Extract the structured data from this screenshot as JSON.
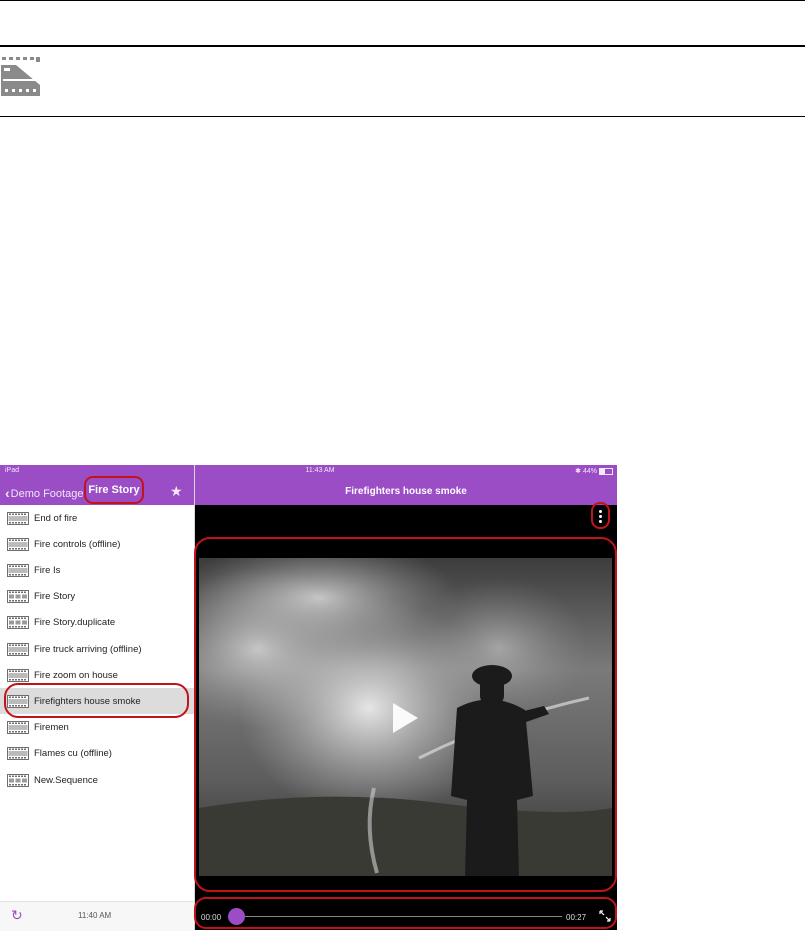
{
  "status_bar": {
    "device": "iPad",
    "time": "11:43 AM",
    "battery": "44%"
  },
  "sidebar": {
    "back_label": "Demo Footage",
    "folder_title": "Fire Story",
    "items": [
      {
        "label": "End of fire",
        "icon": "clip-film-icon",
        "selected": false
      },
      {
        "label": "Fire controls (offline)",
        "icon": "clip-film-icon",
        "selected": false
      },
      {
        "label": "Fire Is",
        "icon": "clip-film-icon",
        "selected": false
      },
      {
        "label": "Fire Story",
        "icon": "sequence-film-icon",
        "selected": false
      },
      {
        "label": "Fire Story.duplicate",
        "icon": "sequence-film-icon",
        "selected": false
      },
      {
        "label": "Fire truck arriving (offline)",
        "icon": "clip-film-icon",
        "selected": false
      },
      {
        "label": "Fire zoom on house",
        "icon": "clip-film-icon",
        "selected": false
      },
      {
        "label": "Firefighters house smoke",
        "icon": "clip-film-icon",
        "selected": true
      },
      {
        "label": "Firemen",
        "icon": "clip-film-icon",
        "selected": false
      },
      {
        "label": "Flames cu (offline)",
        "icon": "clip-film-icon",
        "selected": false
      },
      {
        "label": "New.Sequence",
        "icon": "sequence-film-icon",
        "selected": false
      }
    ],
    "footer_time": "11:40 AM"
  },
  "player": {
    "title": "Firefighters house smoke",
    "time_start": "00:00",
    "time_end": "00:27",
    "progress": 0
  },
  "colors": {
    "accent": "#9b4dc6",
    "callout": "#c0141a"
  }
}
